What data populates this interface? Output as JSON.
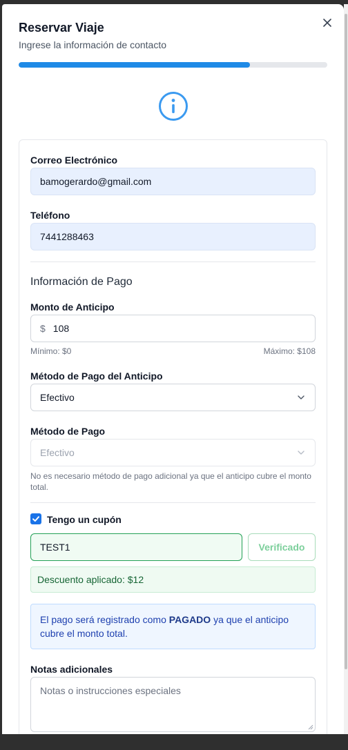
{
  "modal": {
    "title": "Reservar Viaje",
    "subtitle": "Ingrese la información de contacto",
    "progress_fraction": 0.75,
    "close_icon": "close-icon",
    "status_icon": "info-circle-icon",
    "accent_color": "#1f8ae6"
  },
  "contact": {
    "email_label": "Correo Electrónico",
    "email_value": "bamogerardo@gmail.com",
    "phone_label": "Teléfono",
    "phone_value": "7441288463"
  },
  "payment": {
    "section_title": "Información de Pago",
    "advance_label": "Monto de Anticipo",
    "currency_symbol": "$",
    "advance_value": "108",
    "min_hint": "Mínimo: $0",
    "max_hint": "Máximo: $108",
    "advance_method_label": "Método de Pago del Anticipo",
    "advance_method_value": "Efectivo",
    "method_label": "Método de Pago",
    "method_value": "Efectivo",
    "method_note": "No es necesario método de pago adicional ya que el anticipo cubre el monto total."
  },
  "coupon": {
    "checkbox_label": "Tengo un cupón",
    "checked": true,
    "code_value": "TEST1",
    "verify_label": "Verificado",
    "discount_message": "Descuento aplicado: $12"
  },
  "notice": {
    "text_before": "El pago será registrado como ",
    "text_bold": "PAGADO",
    "text_after": " ya que el anticipo cubre el monto total."
  },
  "notes": {
    "label": "Notas adicionales",
    "placeholder": "Notas o instrucciones especiales"
  }
}
